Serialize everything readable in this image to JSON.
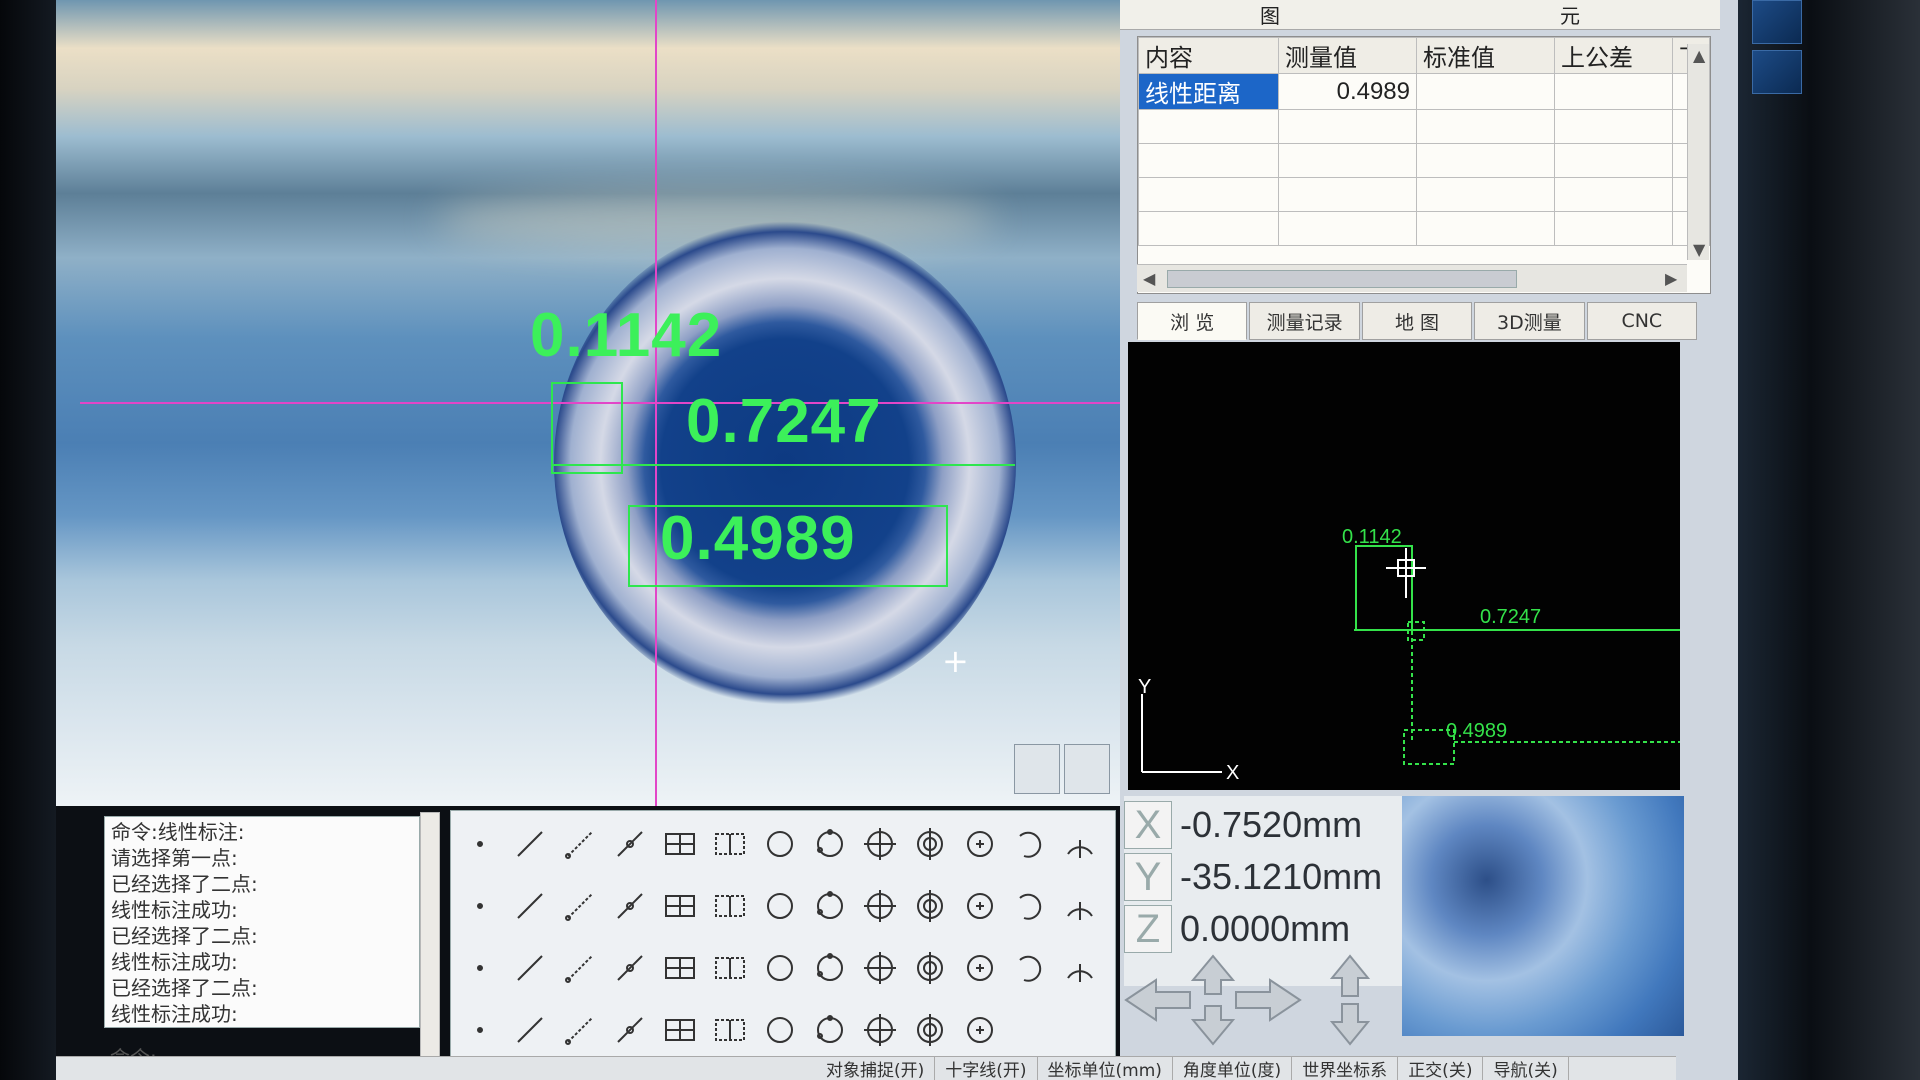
{
  "panel": {
    "title_left": "图",
    "title_right": "元"
  },
  "table": {
    "headers": [
      "内容",
      "测量值",
      "标准值",
      "上公差",
      "下"
    ],
    "rows": [
      [
        "线性距离",
        "0.4989",
        "",
        "",
        ""
      ]
    ]
  },
  "tabs": [
    "浏 览",
    "测量记录",
    "地 图",
    "3D测量",
    "CNC"
  ],
  "measurements": {
    "m1": "0.1142",
    "m2": "0.7247",
    "m3": "0.4989"
  },
  "nav_view": {
    "label_1": "0.1142",
    "label_2": "0.7247",
    "label_3": "0.4989",
    "axis_y": "Y",
    "axis_x": "X"
  },
  "coords": {
    "x_label": "X",
    "y_label": "Y",
    "z_label": "Z",
    "x": "-0.7520mm",
    "y": "-35.1210mm",
    "z": "0.0000mm"
  },
  "command_log": [
    "命令:线性标注:",
    "请选择第一点:",
    "已经选择了二点:",
    "线性标注成功:",
    "已经选择了二点:",
    "线性标注成功:",
    "已经选择了二点:",
    "线性标注成功:"
  ],
  "command_prompt": "命令:",
  "status_bar": [
    "对象捕捉(开)",
    "十字线(开)",
    "坐标单位(mm)",
    "角度单位(度)",
    "世界坐标系",
    "正交(关)",
    "导航(关)"
  ],
  "colors": {
    "measure_green": "#2ee64e",
    "crosshair_magenta": "#e246c8",
    "selected_row": "#1c66c8"
  },
  "toolbar_icons": [
    "point-icon",
    "line-icon",
    "line-2pt-icon",
    "line-perp-icon",
    "grid-table-icon",
    "grid-select-icon",
    "circle-icon",
    "circle-3pt-icon",
    "circle-target-icon",
    "circle-cross-icon",
    "circle-center-icon",
    "arc-icon",
    "arc-3pt-icon",
    "arc-radius-icon",
    "ellipse-icon",
    "ellipse-2-icon",
    "sphere-icon",
    "sphere-2-icon",
    "curve-icon",
    "freeform-icon",
    "perpendicular-icon",
    "parallel-icon",
    "intersect-icon",
    "bisect-icon",
    "cross-icon",
    "diameter-icon",
    "circle-pair-icon",
    "cone-icon",
    "cylinder-icon",
    "angle-icon",
    "lines-icon",
    "circle-line-icon",
    "circle-split-icon",
    "angle-measure-icon",
    "horizontal-dim-icon",
    "diagonal-dim-icon",
    "text-icon",
    "coordinate-icon",
    "h-dim-icon",
    "v-dim-icon",
    "point-dim-icon",
    "radius-dim-icon",
    "pair-dim-icon",
    "copy-icon",
    "select-rect-icon",
    "trim-icon",
    "move-icon",
    "mirror-icon",
    "undo-icon",
    "distance-icon"
  ]
}
